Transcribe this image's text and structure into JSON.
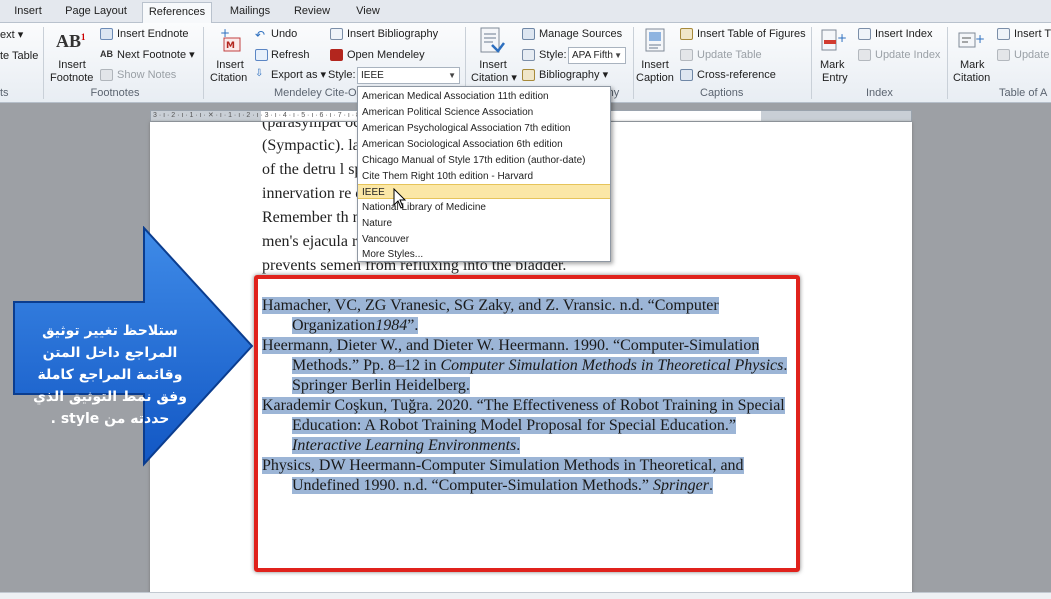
{
  "tabs": [
    "Insert",
    "Page Layout",
    "References",
    "Mailings",
    "Review",
    "View"
  ],
  "ribbon": {
    "toc_partial": [
      "ext ▾",
      "te Table",
      "ts"
    ],
    "footnotes": {
      "insert_endnote": "Insert Endnote",
      "insert_footnote_line1": "Insert",
      "insert_footnote_line2": "Footnote",
      "next_footnote": "Next Footnote ▾",
      "show_notes": "Show Notes",
      "group_label": "Footnotes"
    },
    "mendeley": {
      "undo": "Undo",
      "refresh": "Refresh",
      "export_as": "Export as ▾",
      "insert_bibliography": "Insert Bibliography",
      "open_mendeley": "Open Mendeley",
      "style_label": "Style:",
      "style_value": "IEEE",
      "insert_citation_line1": "Insert",
      "insert_citation_line2": "Citation",
      "group_label": "Mendeley Cite-O"
    },
    "citations": {
      "insert_citation_line1": "Insert",
      "insert_citation_line2": "Citation ▾",
      "manage_sources": "Manage Sources",
      "style_label": "Style:",
      "style_value": "APA Fifth",
      "bibliography": "Bibliography ▾",
      "group_label_tail": "ibliography"
    },
    "captions": {
      "insert_caption_line1": "Insert",
      "insert_caption_line2": "Caption",
      "insert_table_of_figures": "Insert Table of Figures",
      "update_table": "Update Table",
      "cross_reference": "Cross-reference",
      "group_label": "Captions"
    },
    "index": {
      "mark_entry_line1": "Mark",
      "mark_entry_line2": "Entry",
      "insert_index": "Insert Index",
      "update_index": "Update Index",
      "group_label": "Index"
    },
    "toa": {
      "mark_citation_line1": "Mark",
      "mark_citation_line2": "Citation",
      "insert_partial": "Insert T",
      "update_partial": "Update",
      "group_label": "Table of A"
    }
  },
  "ruler": "3 · ı · 2 · ı · 1 · ı · ✕ · ı · 1 · ı · 2 · ı · 3 · ı · 4 · ı · 5 · ı · 6 · ı · 7 · ı · 8 · ı · 9 · ı · 10 · ı · 11 · ı · 12 · ı · 13 · ı · 14 · ı · 15 · ı · 16 · ı · 17 · ı · 18 ·",
  "style_dropdown": [
    "American Medical Association 11th edition",
    "American Political Science Association",
    "American Psychological Association 7th edition",
    "American Sociological Association 6th edition",
    "Chicago Manual of Style 17th edition (author-date)",
    "Cite Them Right 10th edition - Harvard",
    "IEEE",
    "National Library of Medicine",
    "Nature",
    "Vancouver",
    "More Styles..."
  ],
  "body_lines": [
    "(parasympat                                    ocutera) splanchnic nerves.",
    "(Sympactic).                                    ladder stretches the tendon",
    "of the detru                                    l sphincter. Sympathetic",
    "innervation re                                  central urethral sphincter.",
    "Remember th                                     n is very involved during",
    "men's ejacula                                   ral sphincter to close and",
    "prevents semen from refluxing into the bladder."
  ],
  "references": [
    {
      "plain": "Hamacher, VC, ZG Vranesic, SG Zaky, and Z. Vransic. n.d. “Computer Organization",
      "italic": "1984",
      "tail": "”."
    },
    {
      "plain": "Heermann, Dieter W., and Dieter W. Heermann. 1990. “Computer-Simulation Methods.” Pp. 8–12 in ",
      "italic": "Computer Simulation Methods in Theoretical Physics",
      "tail": ". Springer Berlin Heidelberg."
    },
    {
      "plain": "Karademir Coşkun, Tuğra. 2020. “The Effectiveness of Robot Training in Special Education: A Robot Training Model Proposal for Special Education.” ",
      "italic": "Interactive Learning Environments",
      "tail": "."
    },
    {
      "plain": "Physics, DW Heermann-Computer Simulation Methods in Theoretical, and Undefined 1990. n.d. “Computer-Simulation Methods.” ",
      "italic": "Springer",
      "tail": "."
    }
  ],
  "callout_text": "ستلاحظ تغيير توثيق المراجع داخل المتن وقائمة المراجع كاملة وفق نمط التوثيق الذي حددته من style ."
}
